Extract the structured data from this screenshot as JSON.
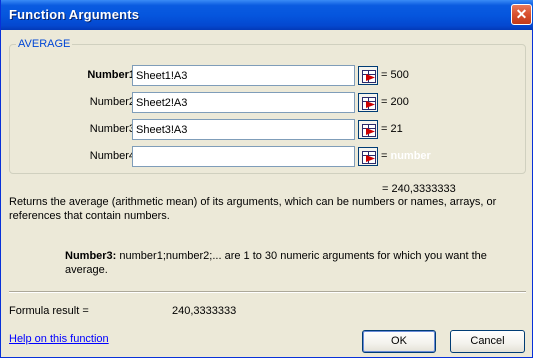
{
  "window": {
    "title": "Function Arguments",
    "close_glyph": "✕"
  },
  "function_group": {
    "name": "AVERAGE",
    "args": [
      {
        "label": "Number1",
        "value": "Sheet1!A3",
        "result": "= 500",
        "bold": true
      },
      {
        "label": "Number2",
        "value": "Sheet2!A3",
        "result": "= 200",
        "bold": false
      },
      {
        "label": "Number3",
        "value": "Sheet3!A3",
        "result": "= 21",
        "bold": false
      },
      {
        "label": "Number4",
        "value": "",
        "result": "= ",
        "hint": "number",
        "bold": false
      }
    ]
  },
  "summary": {
    "result": "= 240,3333333",
    "description": "Returns the average (arithmetic mean) of its arguments, which can be numbers or names, arrays, or references that contain numbers.",
    "arg_name": "Number3:",
    "arg_description": "number1;number2;... are 1 to 30 numeric arguments for which you want the average."
  },
  "formula": {
    "label": "Formula result =",
    "value": "240,3333333"
  },
  "footer": {
    "help_link": "Help on this function",
    "ok_label": "OK",
    "cancel_label": "Cancel"
  },
  "icons": {
    "ref_button": "collapse-dialog-icon"
  },
  "colors": {
    "title_bar": "#0556de",
    "legend": "#0046d5",
    "link": "#0000ff",
    "close": "#d8502e"
  }
}
